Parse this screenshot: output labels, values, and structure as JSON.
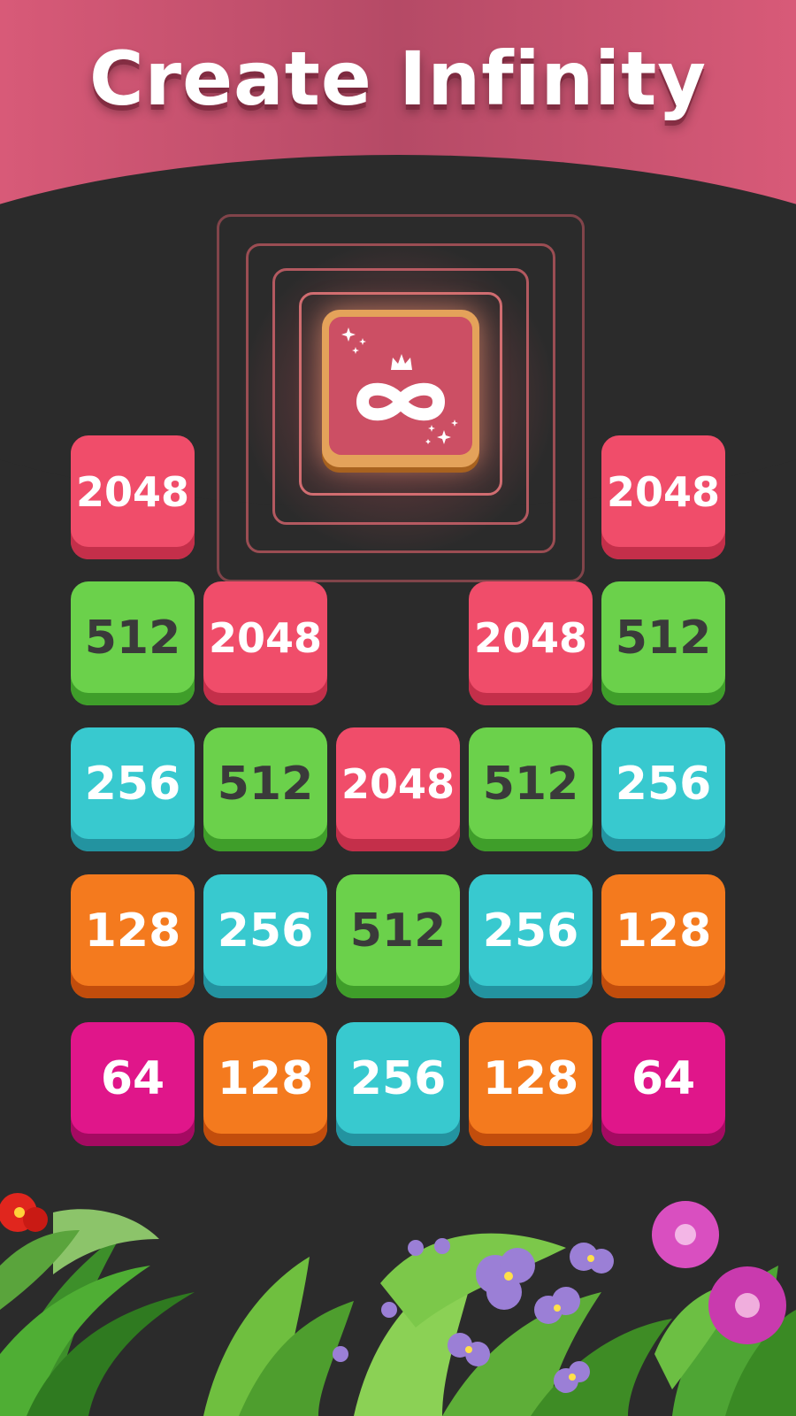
{
  "header": {
    "title": "Create Infinity"
  },
  "special_tile": {
    "icon": "crown-infinity-icon"
  },
  "colors": {
    "header": "#d85a78",
    "background": "#2b2b2b",
    "tile_2048": "#f04d6a",
    "tile_512": "#6bd14b",
    "tile_256": "#38c9cf",
    "tile_128": "#f47a1e",
    "tile_64": "#e0168a"
  },
  "board": {
    "rows": [
      [
        "2048",
        "",
        "",
        "",
        "2048"
      ],
      [
        "512",
        "2048",
        "",
        "2048",
        "512"
      ],
      [
        "256",
        "512",
        "2048",
        "512",
        "256"
      ],
      [
        "128",
        "256",
        "512",
        "256",
        "128"
      ],
      [
        "64",
        "128",
        "256",
        "128",
        "64"
      ]
    ]
  }
}
